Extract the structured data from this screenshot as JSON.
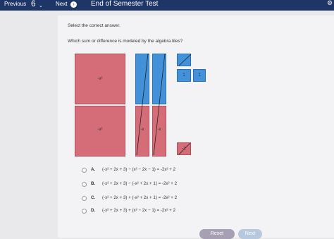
{
  "topbar": {
    "previous": "Previous",
    "question_number": "6",
    "next": "Next",
    "title": "End of Semester Test"
  },
  "prompt": {
    "instruction": "Select the correct answer.",
    "question": "Which sum or difference is modeled by the algebra tiles?"
  },
  "tiles": {
    "big_red_label": "-x²",
    "small_blue_label": "1",
    "small_red_label": "-1",
    "bar_red_label": "-x"
  },
  "choices": [
    {
      "letter": "A.",
      "expr": "(-x² + 2x + 3) − (x² − 2x − 1) = -2x² + 2"
    },
    {
      "letter": "B.",
      "expr": "(-x² + 2x + 3) − (-x² + 2x + 1) = -2x² + 2"
    },
    {
      "letter": "C.",
      "expr": "(-x² + 2x + 3) + (-x² + 2x + 1) = -2x² + 2"
    },
    {
      "letter": "D.",
      "expr": "(-x² + 2x + 3) + (x² − 2x − 1) = -2x² + 2"
    }
  ],
  "buttons": {
    "reset": "Reset",
    "next": "Next"
  },
  "colors": {
    "topbar": "#1e3568",
    "tile_red": "#d56d79",
    "tile_blue": "#4391d9"
  }
}
